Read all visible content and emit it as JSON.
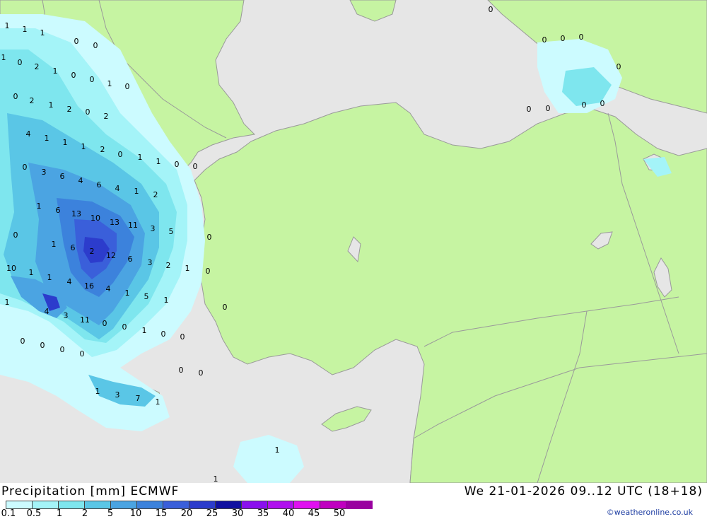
{
  "title": "Precipitation [mm] ECMWF",
  "valid_time": "We 21-01-2026 09..12 UTC (18+18)",
  "credit": "©weatheronline.co.uk",
  "legend": {
    "ticks": [
      "0.1",
      "0.5",
      "1",
      "2",
      "5",
      "10",
      "15",
      "20",
      "25",
      "30",
      "35",
      "40",
      "45",
      "50"
    ],
    "colors": [
      "#ccfbff",
      "#a4f4f8",
      "#7ee6ee",
      "#5ac6e6",
      "#4ba4e2",
      "#3c82dc",
      "#3a5fda",
      "#2c3ccc",
      "#1010a0",
      "#8a10ee",
      "#b010ee",
      "#e010f0",
      "#c000c0",
      "#9a00a0"
    ]
  },
  "colors": {
    "land": "#c6f4a2",
    "sea": "#e6e6e6",
    "border": "#9a9a9a"
  },
  "map_labels": [
    "1",
    "1",
    "1",
    "1",
    "0",
    "0",
    "0",
    "2",
    "1",
    "0",
    "0",
    "1",
    "0",
    "2",
    "1",
    "2",
    "0",
    "0",
    "2",
    "4",
    "1",
    "1",
    "1",
    "2",
    "0",
    "1",
    "1",
    "0",
    "3",
    "6",
    "4",
    "6",
    "4",
    "1",
    "2",
    "0",
    "0",
    "1",
    "6",
    "13",
    "10",
    "13",
    "11",
    "3",
    "5",
    "0",
    "0",
    "1",
    "6",
    "2",
    "12",
    "6",
    "3",
    "2",
    "1",
    "0",
    "10",
    "1",
    "1",
    "4",
    "16",
    "4",
    "1",
    "5",
    "1",
    "0",
    "1",
    "4",
    "3",
    "11",
    "0",
    "0",
    "1",
    "0",
    "0",
    "0",
    "0",
    "0",
    "0",
    "0",
    "0",
    "1",
    "3",
    "7",
    "1",
    "1",
    "1",
    "0",
    "0",
    "0",
    "0",
    "0",
    "0",
    "0",
    "0",
    "0"
  ]
}
